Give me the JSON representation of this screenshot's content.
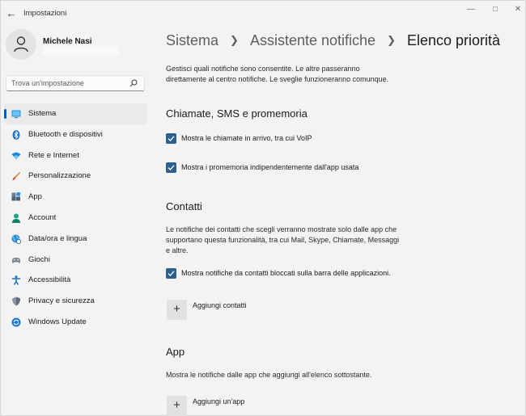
{
  "window": {
    "title": "Impostazioni",
    "back_icon": "arrow-left-icon",
    "controls": [
      "minimize",
      "maximize",
      "close"
    ]
  },
  "user": {
    "name": "Michele Nasi"
  },
  "search": {
    "placeholder": "Trova un'impostazione"
  },
  "sidebar": {
    "items": [
      {
        "label": "Sistema",
        "icon": "monitor-icon",
        "active": true
      },
      {
        "label": "Bluetooth e dispositivi",
        "icon": "bluetooth-icon",
        "active": false
      },
      {
        "label": "Rete e Internet",
        "icon": "wifi-icon",
        "active": false
      },
      {
        "label": "Personalizzazione",
        "icon": "brush-icon",
        "active": false
      },
      {
        "label": "App",
        "icon": "apps-icon",
        "active": false
      },
      {
        "label": "Account",
        "icon": "person-icon",
        "active": false
      },
      {
        "label": "Data/ora e lingua",
        "icon": "globe-clock-icon",
        "active": false
      },
      {
        "label": "Giochi",
        "icon": "gamepad-icon",
        "active": false
      },
      {
        "label": "Accessibilità",
        "icon": "accessibility-icon",
        "active": false
      },
      {
        "label": "Privacy e sicurezza",
        "icon": "shield-icon",
        "active": false
      },
      {
        "label": "Windows Update",
        "icon": "update-icon",
        "active": false
      }
    ]
  },
  "breadcrumb": {
    "item1": "Sistema",
    "item2": "Assistente notifiche",
    "current": "Elenco priorità"
  },
  "main": {
    "intro_line1": "Gestisci quali notifiche sono consentite. Le altre passeranno",
    "intro_line2": "direttamente al centro notifiche. Le sveglie funzioneranno comunque.",
    "calls_section": {
      "title": "Chiamate, SMS e promemoria",
      "options": [
        {
          "label": "Mostra le chiamate in arrivo, tra cui VoIP",
          "checked": true
        },
        {
          "label": "Mostra i promemoria indipendentemente dall'app usata",
          "checked": true
        }
      ]
    },
    "contacts_section": {
      "title": "Contatti",
      "desc_line1": "Le notifiche dei contatti che scegli verranno mostrate solo dalle app che",
      "desc_line2": "supportano questa funzionalità, tra cui Mail, Skype, Chiamate, Messaggi",
      "desc_line3": "e altre.",
      "option": {
        "label": "Mostra notifiche da contatti bloccati sulla barra delle applicazioni.",
        "checked": true
      },
      "add_label": "Aggiungi contatti"
    },
    "apps_section": {
      "title": "App",
      "desc": "Mostra le notifiche dalle app che aggiungi all'elenco sottostante.",
      "add_label": "Aggiungi un'app"
    }
  },
  "colors": {
    "accent": "#005fb8",
    "checkbox": "#2c5f8b",
    "background": "#f3f3f3"
  }
}
